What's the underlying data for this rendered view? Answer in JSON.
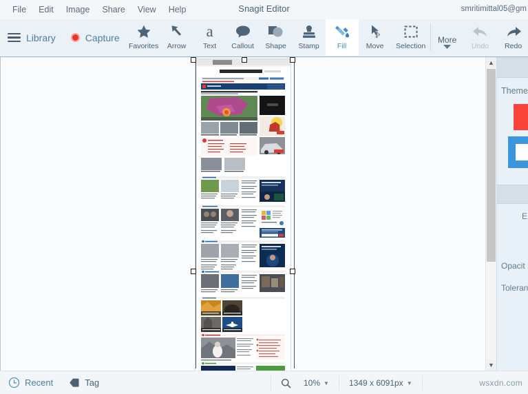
{
  "window": {
    "title": "Snagit Editor",
    "account": "smritimittal05@gm"
  },
  "menubar": {
    "items": [
      {
        "label": "File",
        "name": "menu-file"
      },
      {
        "label": "Edit",
        "name": "menu-edit"
      },
      {
        "label": "Image",
        "name": "menu-image"
      },
      {
        "label": "Share",
        "name": "menu-share"
      },
      {
        "label": "View",
        "name": "menu-view"
      },
      {
        "label": "Help",
        "name": "menu-help"
      }
    ]
  },
  "toolbar": {
    "library_label": "Library",
    "capture_label": "Capture",
    "tools": [
      {
        "label": "Favorites",
        "icon": "star-icon",
        "active": false,
        "disabled": false
      },
      {
        "label": "Arrow",
        "icon": "arrow-icon",
        "active": false,
        "disabled": false
      },
      {
        "label": "Text",
        "icon": "text-icon",
        "active": false,
        "disabled": false
      },
      {
        "label": "Callout",
        "icon": "callout-icon",
        "active": false,
        "disabled": false
      },
      {
        "label": "Shape",
        "icon": "shape-icon",
        "active": false,
        "disabled": false
      },
      {
        "label": "Stamp",
        "icon": "stamp-icon",
        "active": false,
        "disabled": false
      },
      {
        "label": "Fill",
        "icon": "fill-icon",
        "active": true,
        "disabled": false
      },
      {
        "label": "Move",
        "icon": "move-icon",
        "active": false,
        "disabled": false
      },
      {
        "label": "Selection",
        "icon": "selection-icon",
        "active": false,
        "disabled": false
      },
      {
        "label": "More",
        "icon": "more-icon",
        "active": false,
        "disabled": false
      },
      {
        "label": "Undo",
        "icon": "undo-icon",
        "active": false,
        "disabled": true
      },
      {
        "label": "Redo",
        "icon": "redo-icon",
        "active": false,
        "disabled": false
      }
    ]
  },
  "canvas": {
    "image_alt": "The Hindu newspaper homepage screenshot",
    "selection_handles": 6
  },
  "properties_panel": {
    "themes_label": "Themes",
    "effects_label": "E",
    "opacity_label": "Opacit",
    "tolerance_label": "Toleran",
    "swatch_red": "#f9423a",
    "swatch_blue": "#3d96dd"
  },
  "statusbar": {
    "recent_label": "Recent",
    "tag_label": "Tag",
    "zoom_level": "10%",
    "dimensions": "1349 x 6091px",
    "watermark": "wsxdn.com"
  }
}
